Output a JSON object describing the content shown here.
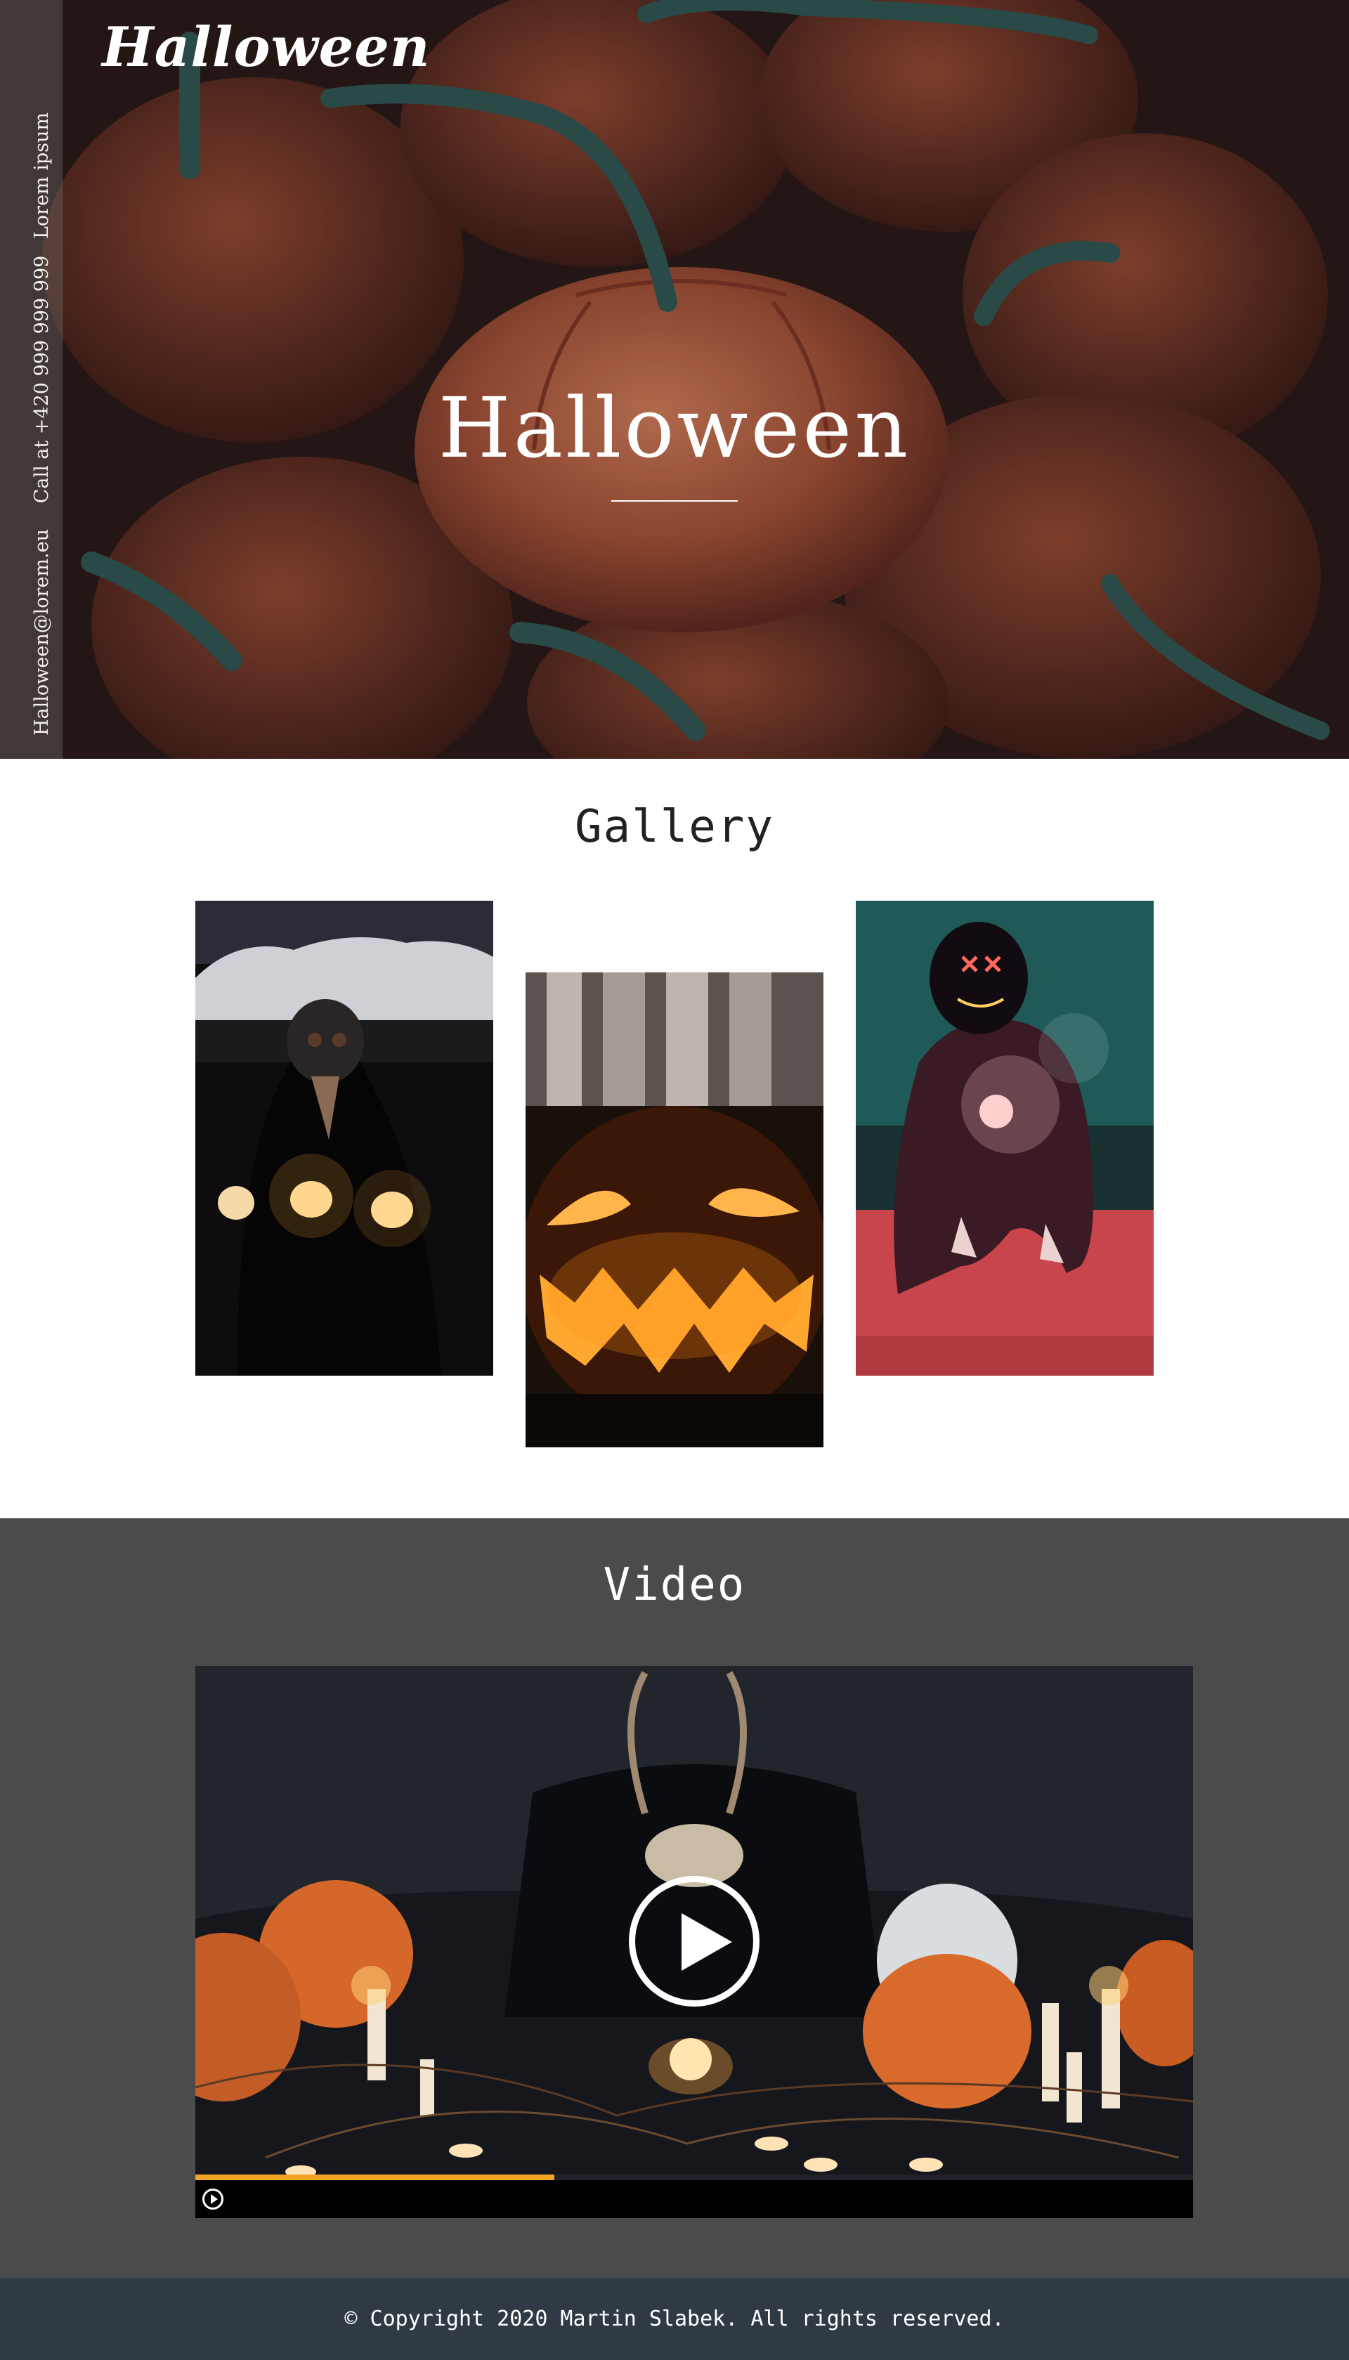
{
  "header": {
    "logo": "Halloween",
    "side_links": [
      "Lorem ipsum",
      "Call at +420 999 999 999",
      "Halloween@lorem.eu"
    ],
    "hero_title": "Halloween"
  },
  "gallery": {
    "title": "Gallery",
    "images": [
      {
        "name": "plague-doctor-with-candles-photo"
      },
      {
        "name": "jack-o-lantern-photo"
      },
      {
        "name": "neon-mask-sparkler-photo"
      }
    ]
  },
  "video": {
    "title": "Video",
    "progress_fraction": 0.36
  },
  "footer": {
    "copyright": "© Copyright 2020 Martin Slabek. All rights reserved."
  },
  "colors": {
    "video_bg": "#4b4b4b",
    "footer_bg": "#2f3a44",
    "progress": "#f0a623"
  }
}
